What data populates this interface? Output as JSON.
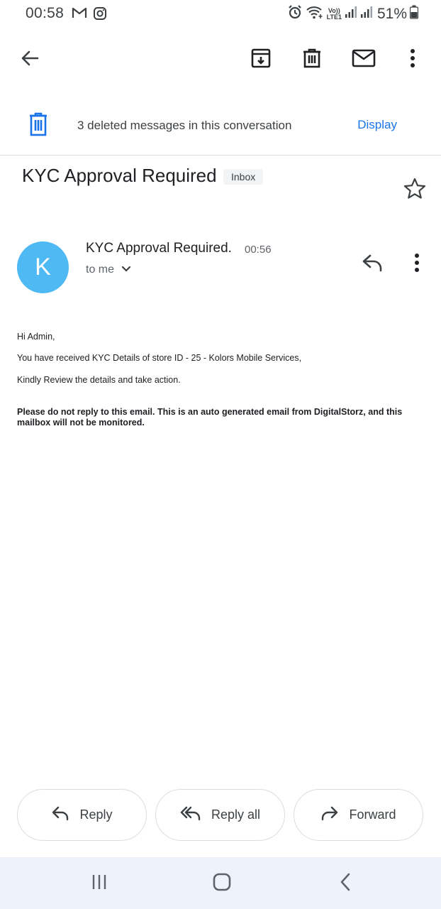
{
  "status_bar": {
    "time": "00:58",
    "lte_top": "Vo))",
    "lte_bottom": "LTE1",
    "battery": "51%"
  },
  "toolbar": {
    "back_icon": "arrow-back-icon",
    "archive_icon": "archive-icon",
    "delete_icon": "trash-icon",
    "mark_unread_icon": "mail-icon",
    "more_icon": "more-vert-icon"
  },
  "deleted_banner": {
    "text": "3 deleted messages in this conversation",
    "action": "Display"
  },
  "subject": {
    "title": "KYC Approval Required",
    "label": "Inbox"
  },
  "message": {
    "avatar_letter": "K",
    "sender": "KYC Approval Required.",
    "time": "00:56",
    "recipient": "to me",
    "body": [
      "Hi Admin,",
      "You have received KYC Details of store ID - 25 - Kolors Mobile Services,",
      "Kindly Review the details and take action."
    ],
    "footer_note": "Please do not reply to this email. This is an auto generated email from DigitalStorz, and this mailbox will not be monitored."
  },
  "actions": {
    "reply": "Reply",
    "reply_all": "Reply all",
    "forward": "Forward"
  },
  "colors": {
    "accent": "#1a73e8",
    "avatar": "#4fb9f3",
    "nav_bg": "#eef2fb"
  }
}
